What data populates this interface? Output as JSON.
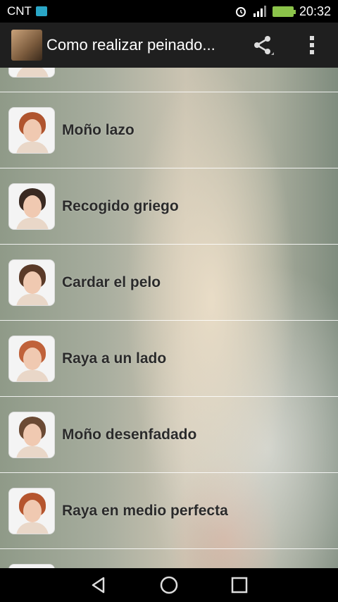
{
  "status_bar": {
    "carrier": "CNT",
    "time": "20:32",
    "icons": [
      "gallery-icon",
      "alarm-icon",
      "signal-icon",
      "battery-charging-icon"
    ]
  },
  "action_bar": {
    "title": "Como realizar peinado...",
    "share_icon": "share-icon",
    "overflow_icon": "overflow-menu-icon"
  },
  "list": {
    "items": [
      {
        "label": "",
        "hair": "#c98f6a"
      },
      {
        "label": "Moño lazo",
        "hair": "#b0552f"
      },
      {
        "label": "Recogido griego",
        "hair": "#3a2a22"
      },
      {
        "label": "Cardar el pelo",
        "hair": "#5a3a28"
      },
      {
        "label": "Raya a un lado",
        "hair": "#c0623a"
      },
      {
        "label": "Moño desenfadado",
        "hair": "#6b4a34"
      },
      {
        "label": "Raya en medio perfecta",
        "hair": "#b5552e"
      },
      {
        "label": "",
        "hair": "#7a5a48"
      }
    ]
  },
  "nav_bar": {
    "icons": [
      "back-icon",
      "home-icon",
      "recents-icon"
    ]
  }
}
